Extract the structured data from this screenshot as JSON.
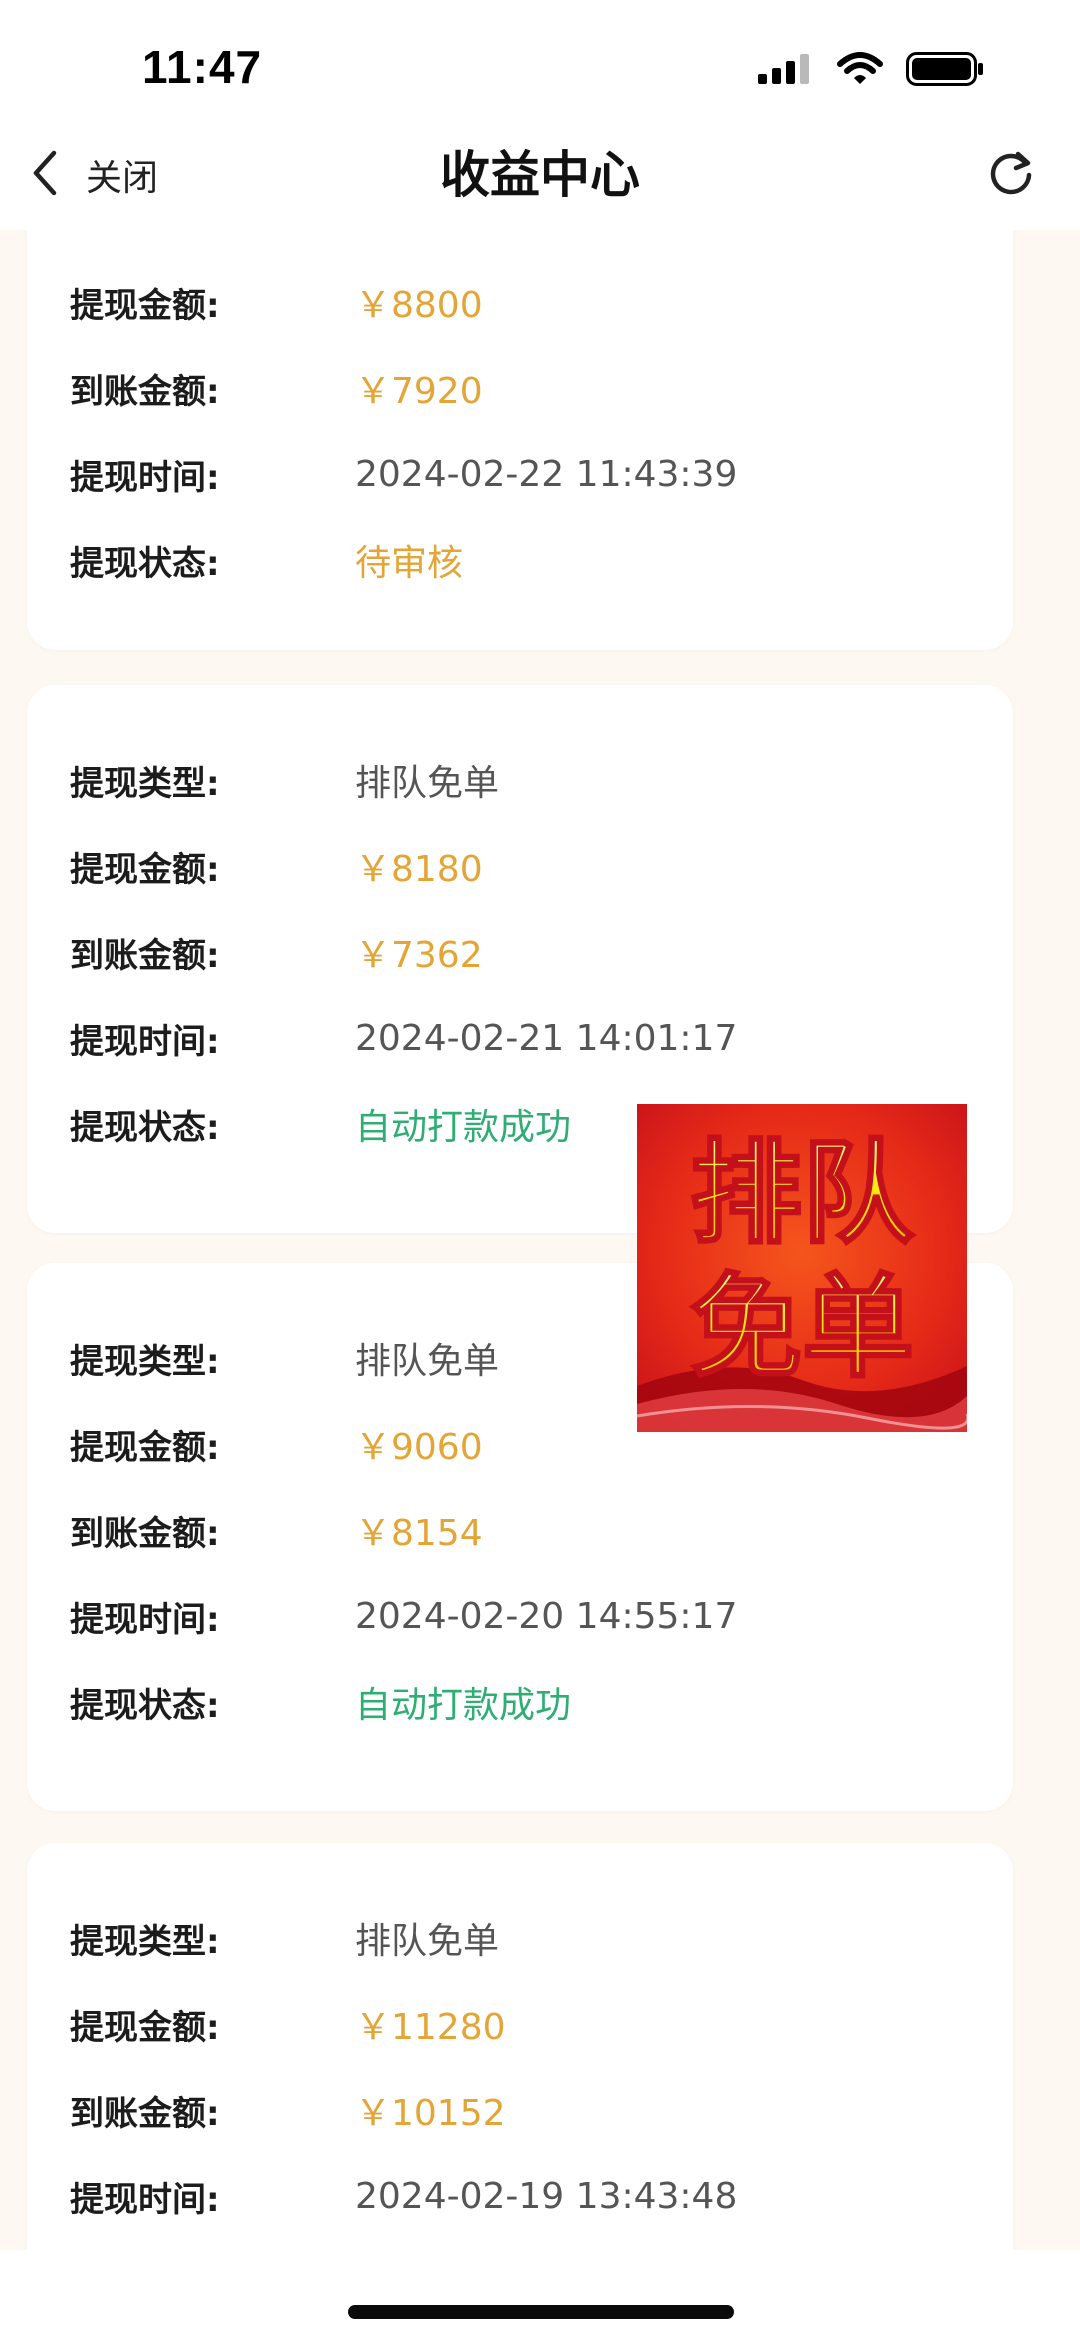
{
  "status_bar": {
    "time": "11:47"
  },
  "nav": {
    "back_label": "关闭",
    "title": "收益中心"
  },
  "labels": {
    "type": "提现类型:",
    "amount": "提现金额:",
    "received": "到账金额:",
    "time": "提现时间:",
    "status": "提现状态:"
  },
  "records": [
    {
      "amount": "￥8800",
      "received": "￥7920",
      "time": "2024-02-22 11:43:39",
      "status": "待审核"
    },
    {
      "type": "排队免单",
      "amount": "￥8180",
      "received": "￥7362",
      "time": "2024-02-21 14:01:17",
      "status": "自动打款成功"
    },
    {
      "type": "排队免单",
      "amount": "￥9060",
      "received": "￥8154",
      "time": "2024-02-20 14:55:17",
      "status": "自动打款成功"
    },
    {
      "type": "排队免单",
      "amount": "￥11280",
      "received": "￥10152",
      "time": "2024-02-19 13:43:48"
    }
  ],
  "promo": {
    "line1": "排队",
    "line2": "免单"
  },
  "colors": {
    "money": "#e4a537",
    "pending": "#e4a537",
    "success": "#2fae74",
    "page_bg": "#fdf8f2"
  }
}
